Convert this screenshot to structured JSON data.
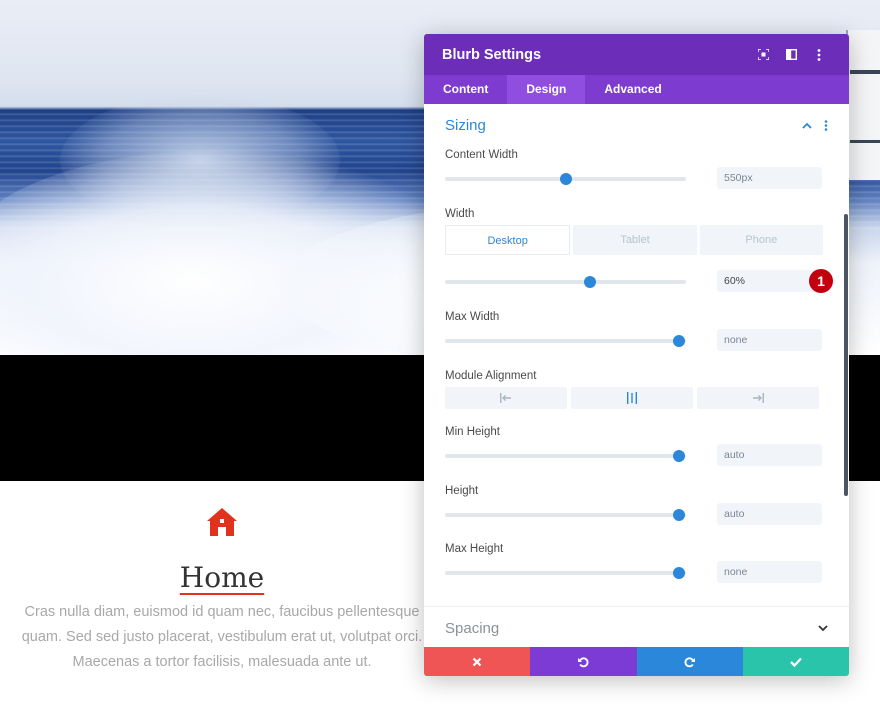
{
  "colors": {
    "header_bg": "#6c2eb9",
    "tabs_bg": "#7e3bd0",
    "active_tab_bg": "#8f4ee0",
    "accent_blue": "#2b87da",
    "discard": "#ef5555",
    "undo": "#7b3bd4",
    "redo": "#2b87da",
    "save": "#29c4a9",
    "badge": "#c0000f",
    "blurb_icon": "#e0321c"
  },
  "modal": {
    "title": "Blurb Settings",
    "header_icons": [
      "focus-icon",
      "split-view-icon",
      "more-vertical-icon"
    ],
    "tabs": [
      {
        "label": "Content",
        "active": false
      },
      {
        "label": "Design",
        "active": true
      },
      {
        "label": "Advanced",
        "active": false
      }
    ]
  },
  "sizing": {
    "title": "Sizing",
    "content_width": {
      "label": "Content Width",
      "value": "550px",
      "slider": 0.5
    },
    "width": {
      "label": "Width",
      "devices": [
        "Desktop",
        "Tablet",
        "Phone"
      ],
      "active_device": "Desktop",
      "value": "60%",
      "slider": 0.6,
      "badge": "1"
    },
    "max_width": {
      "label": "Max Width",
      "value": "none",
      "slider": 0.97
    },
    "module_alignment": {
      "label": "Module Alignment",
      "options": [
        "align-left-icon",
        "align-center-icon",
        "align-right-icon"
      ]
    },
    "min_height": {
      "label": "Min Height",
      "value": "auto",
      "slider": 0.97
    },
    "height": {
      "label": "Height",
      "value": "auto",
      "slider": 0.97
    },
    "max_height": {
      "label": "Max Height",
      "value": "none",
      "slider": 0.97
    }
  },
  "spacing": {
    "title": "Spacing"
  },
  "footer": [
    "discard-icon",
    "undo-icon",
    "redo-icon",
    "save-check-icon"
  ],
  "blurb": {
    "icon": "home-icon",
    "title": "Home",
    "body": "Cras nulla diam, euismod id quam nec, faucibus pellentesque quam. Sed sed justo placerat, vestibulum erat ut, volutpat orci. Maecenas a tortor facilisis, malesuada ante ut."
  }
}
